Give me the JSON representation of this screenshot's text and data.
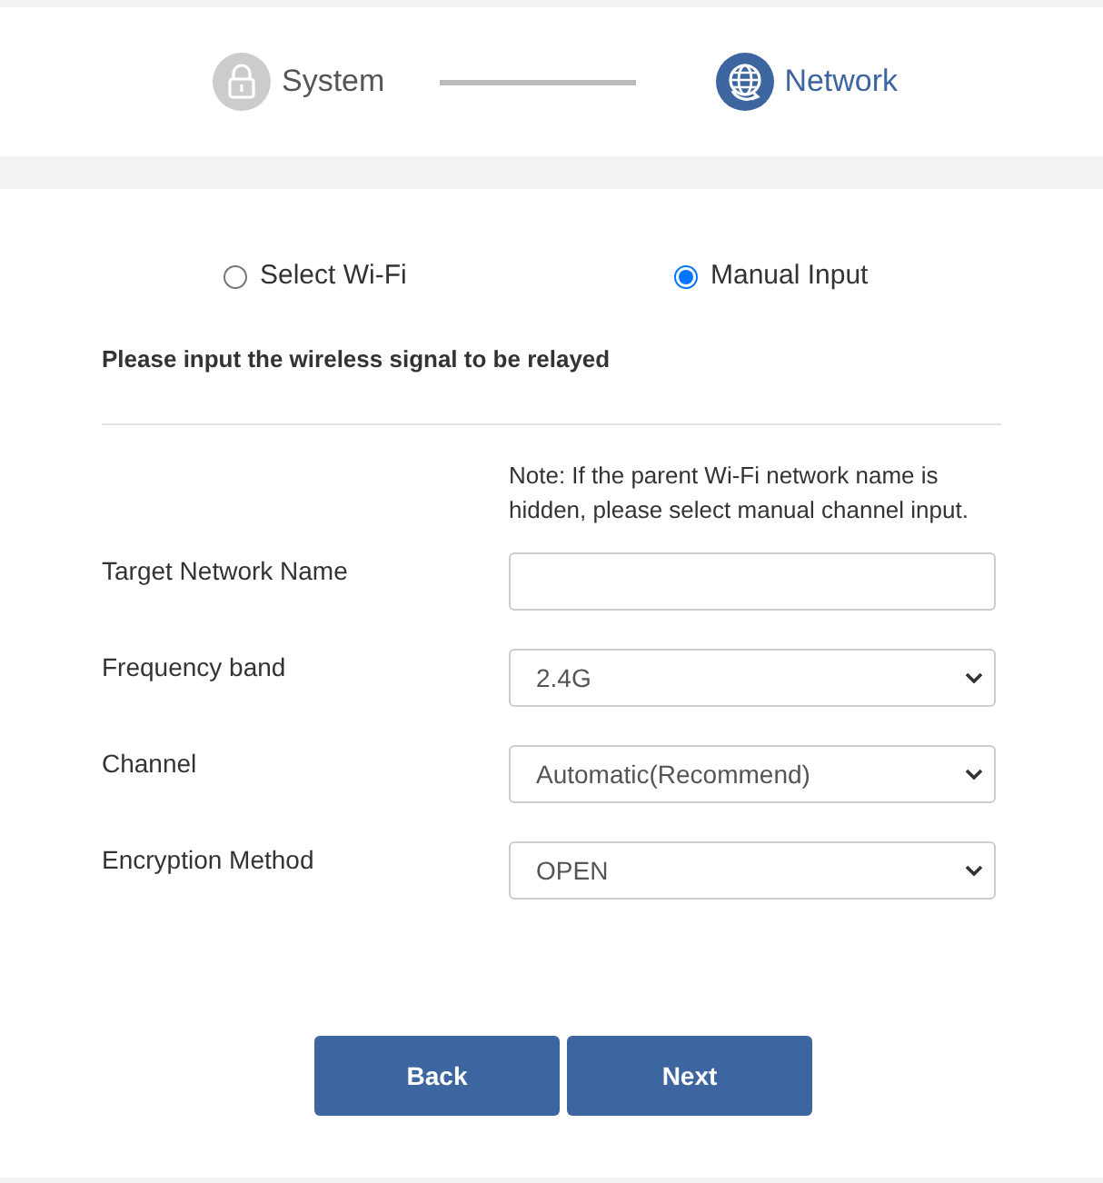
{
  "steps": [
    {
      "label": "System",
      "current": false
    },
    {
      "label": "Network",
      "current": true
    }
  ],
  "mode_options": [
    {
      "label": "Select Wi-Fi",
      "selected": false
    },
    {
      "label": "Manual Input",
      "selected": true
    }
  ],
  "heading": "Please input the wireless signal to be relayed",
  "note": "Note: If the parent Wi-Fi network name is hidden, please select manual channel input.",
  "fields": [
    {
      "kind": "text",
      "label": "Target Network Name"
    },
    {
      "kind": "select",
      "label": "Frequency band",
      "value": "2.4G"
    },
    {
      "kind": "select",
      "label": "Channel",
      "value": "Automatic(Recommend)"
    },
    {
      "kind": "select",
      "label": "Encryption Method",
      "value": "OPEN"
    }
  ],
  "buttons": [
    {
      "label": "Back"
    },
    {
      "label": "Next"
    }
  ]
}
